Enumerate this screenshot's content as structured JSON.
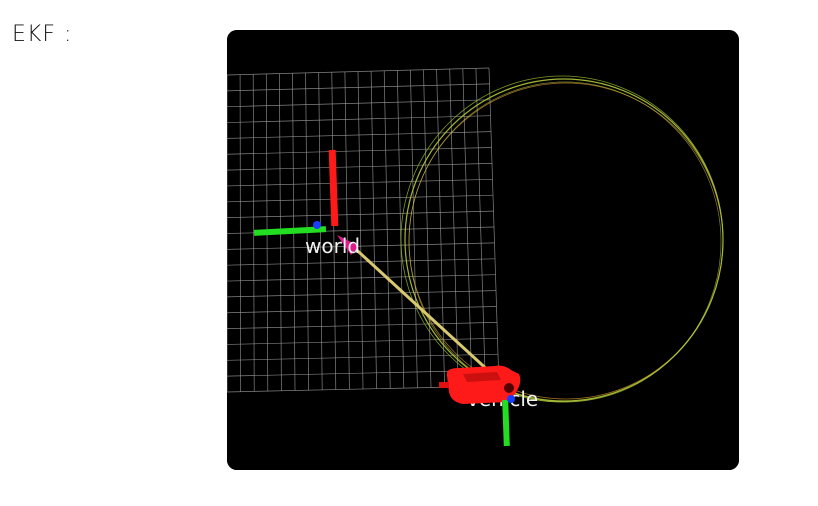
{
  "annotation": {
    "text": "EKF :"
  },
  "scene": {
    "background": "#000000",
    "frames": {
      "world_label": "world",
      "vehicle_label": "vehicle"
    },
    "colors": {
      "grid": "#9a9a9a",
      "trajectory": "#b5c93a",
      "trajectory_inner": "#e0a030",
      "axis_x": "#ff1a1a",
      "axis_y": "#22dd22",
      "axis_z": "#1a3cff",
      "link": "#d8c870",
      "vehicle_body": "#ff1a1a",
      "marker": "#e01a8a"
    }
  }
}
